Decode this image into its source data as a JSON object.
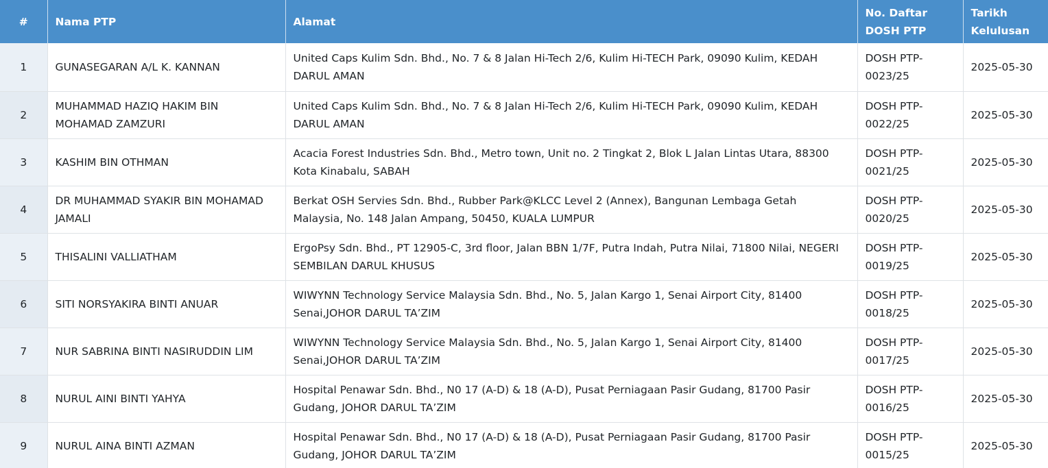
{
  "table": {
    "headers": {
      "num": "#",
      "name": "Nama PTP",
      "address": "Alamat",
      "reg_no": "No. Daftar DOSH PTP",
      "date": "Tarikh Kelulusan"
    },
    "rows": [
      {
        "num": "1",
        "name": "GUNASEGARAN A/L K. KANNAN",
        "address": "United Caps Kulim Sdn. Bhd., No. 7 & 8 Jalan Hi-Tech 2/6, Kulim Hi-TECH Park, 09090 Kulim, KEDAH DARUL AMAN",
        "reg_no": "DOSH PTP-0023/25",
        "date": "2025-05-30"
      },
      {
        "num": "2",
        "name": "MUHAMMAD HAZIQ HAKIM BIN MOHAMAD ZAMZURI",
        "address": "United Caps Kulim Sdn. Bhd., No. 7 & 8 Jalan Hi-Tech 2/6, Kulim Hi-TECH Park, 09090 Kulim, KEDAH DARUL AMAN",
        "reg_no": "DOSH PTP-0022/25",
        "date": "2025-05-30"
      },
      {
        "num": "3",
        "name": "KASHIM BIN OTHMAN",
        "address": "Acacia Forest Industries Sdn. Bhd., Metro town, Unit no. 2 Tingkat 2, Blok L Jalan Lintas Utara, 88300 Kota Kinabalu, SABAH",
        "reg_no": "DOSH PTP-0021/25",
        "date": "2025-05-30"
      },
      {
        "num": "4",
        "name": "DR MUHAMMAD SYAKIR BIN MOHAMAD JAMALI",
        "address": "Berkat OSH Servies Sdn. Bhd., Rubber Park@KLCC Level 2 (Annex), Bangunan Lembaga Getah Malaysia, No. 148 Jalan Ampang, 50450, KUALA LUMPUR",
        "reg_no": "DOSH PTP-0020/25",
        "date": "2025-05-30"
      },
      {
        "num": "5",
        "name": "THISALINI VALLIATHAM",
        "address": "ErgoPsy Sdn. Bhd., PT 12905-C, 3rd floor, Jalan BBN 1/7F, Putra Indah, Putra Nilai, 71800 Nilai, NEGERI SEMBILAN DARUL KHUSUS",
        "reg_no": "DOSH PTP-0019/25",
        "date": "2025-05-30"
      },
      {
        "num": "6",
        "name": "SITI NORSYAKIRA BINTI ANUAR",
        "address": "WIWYNN Technology Service Malaysia Sdn. Bhd., No. 5, Jalan Kargo 1, Senai Airport City, 81400 Senai,JOHOR DARUL TA’ZIM",
        "reg_no": "DOSH PTP-0018/25",
        "date": "2025-05-30"
      },
      {
        "num": "7",
        "name": "NUR SABRINA BINTI NASIRUDDIN LIM",
        "address": "WIWYNN Technology Service Malaysia Sdn. Bhd., No. 5, Jalan Kargo 1, Senai Airport City, 81400 Senai,JOHOR DARUL TA’ZIM",
        "reg_no": "DOSH PTP-0017/25",
        "date": "2025-05-30"
      },
      {
        "num": "8",
        "name": "NURUL AINI BINTI YAHYA",
        "address": "Hospital Penawar Sdn. Bhd., N0 17 (A-D) & 18 (A-D), Pusat Perniagaan Pasir Gudang, 81700 Pasir Gudang, JOHOR DARUL TA’ZIM",
        "reg_no": "DOSH PTP-0016/25",
        "date": "2025-05-30"
      },
      {
        "num": "9",
        "name": "NURUL AINA BINTI AZMAN",
        "address": "Hospital Penawar Sdn. Bhd., N0 17 (A-D) & 18 (A-D), Pusat Perniagaan Pasir Gudang, 81700 Pasir Gudang, JOHOR DARUL TA’ZIM",
        "reg_no": "DOSH PTP-0015/25",
        "date": "2025-05-30"
      }
    ]
  }
}
